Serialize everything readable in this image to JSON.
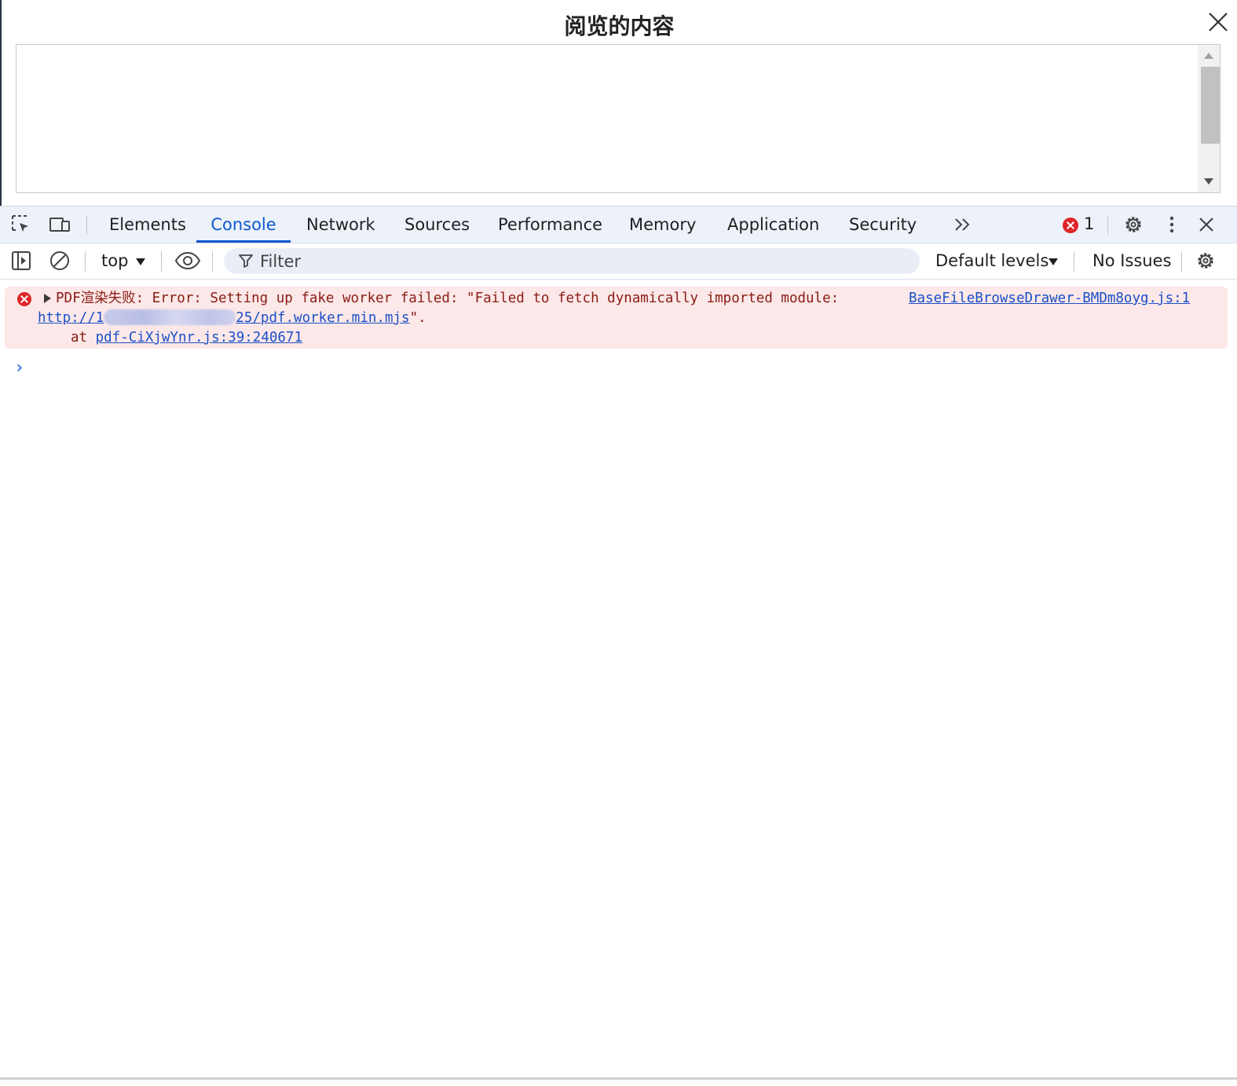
{
  "modal": {
    "title": "阅览的内容"
  },
  "devtools": {
    "tabs": [
      "Elements",
      "Console",
      "Network",
      "Sources",
      "Performance",
      "Memory",
      "Application",
      "Security"
    ],
    "active_tab": "Console",
    "error_count": "1",
    "toolbar": {
      "context": "top",
      "filter_placeholder": "Filter",
      "levels": "Default levels",
      "issues": "No Issues"
    }
  },
  "console": {
    "message": {
      "level": "error",
      "text": "PDF渲染失败: Error: Setting up fake worker failed: \"Failed to fetch dynamically imported module:",
      "source": "BaseFileBrowseDrawer-BMDm8oyg.js:1",
      "url_start": "http://1",
      "url_end": "25/pdf.worker.min.mjs",
      "url_suffix": "\".",
      "stack_prefix": "at ",
      "stack_link": "pdf-CiXjwYnr.js:39:240671"
    },
    "prompt": "›"
  },
  "colors": {
    "accent": "#0b57d0",
    "error_bg": "#fce8e8",
    "error_text": "#8a1c14",
    "error_icon": "#e0262a",
    "tabbar_bg": "#edf2fa"
  }
}
